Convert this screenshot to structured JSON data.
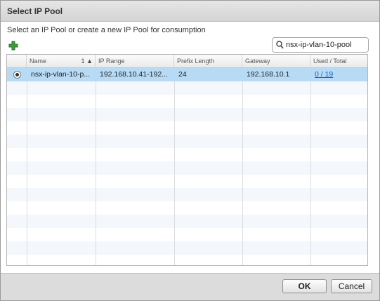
{
  "dialog": {
    "title": "Select IP Pool",
    "instruction": "Select an IP Pool or create a new IP Pool for consumption"
  },
  "toolbar": {
    "add_icon": "green-plus-icon",
    "accent_color": "#3da037"
  },
  "search": {
    "value": "nsx-ip-vlan-10-pool",
    "icon": "search-icon"
  },
  "grid": {
    "columns": [
      {
        "key": "name",
        "label": "Name",
        "sort_order": "1",
        "sort_direction": "▲"
      },
      {
        "key": "ip_range",
        "label": "IP Range"
      },
      {
        "key": "prefix_length",
        "label": "Prefix Length"
      },
      {
        "key": "gateway",
        "label": "Gateway"
      },
      {
        "key": "used_total",
        "label": "Used / Total"
      }
    ],
    "rows": [
      {
        "selected": true,
        "name": "nsx-ip-vlan-10-p...",
        "ip_range": "192.168.10.41-192...",
        "prefix_length": "24",
        "gateway": "192.168.10.1",
        "used_total": "0 / 19"
      }
    ],
    "selected_row_color": "#b7dbf4"
  },
  "footer": {
    "ok_label": "OK",
    "cancel_label": "Cancel"
  }
}
